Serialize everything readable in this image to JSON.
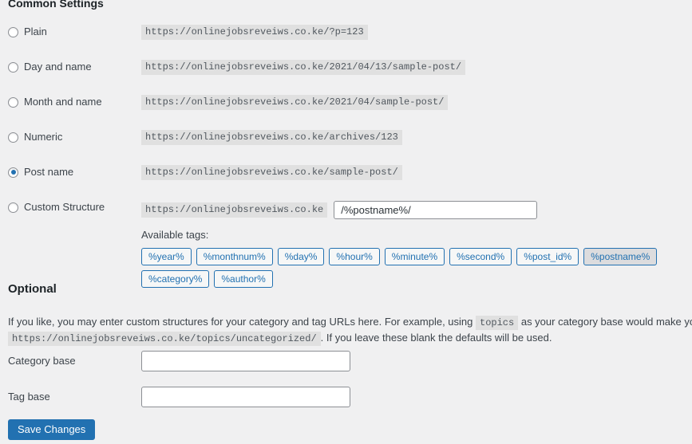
{
  "common_settings": {
    "heading": "Common Settings",
    "options": [
      {
        "label": "Plain",
        "example": "https://onlinejobsreveiws.co.ke/?p=123",
        "selected": false
      },
      {
        "label": "Day and name",
        "example": "https://onlinejobsreveiws.co.ke/2021/04/13/sample-post/",
        "selected": false
      },
      {
        "label": "Month and name",
        "example": "https://onlinejobsreveiws.co.ke/2021/04/sample-post/",
        "selected": false
      },
      {
        "label": "Numeric",
        "example": "https://onlinejobsreveiws.co.ke/archives/123",
        "selected": false
      },
      {
        "label": "Post name",
        "example": "https://onlinejobsreveiws.co.ke/sample-post/",
        "selected": true
      }
    ],
    "custom_structure": {
      "label": "Custom Structure",
      "selected": false,
      "prefix": "https://onlinejobsreveiws.co.ke",
      "value": "/%postname%/",
      "available_tags_label": "Available tags:",
      "tags": [
        {
          "label": "%year%",
          "active": false
        },
        {
          "label": "%monthnum%",
          "active": false
        },
        {
          "label": "%day%",
          "active": false
        },
        {
          "label": "%hour%",
          "active": false
        },
        {
          "label": "%minute%",
          "active": false
        },
        {
          "label": "%second%",
          "active": false
        },
        {
          "label": "%post_id%",
          "active": false
        },
        {
          "label": "%postname%",
          "active": true
        },
        {
          "label": "%category%",
          "active": false
        },
        {
          "label": "%author%",
          "active": false
        }
      ]
    }
  },
  "optional": {
    "heading": "Optional",
    "description_part1": "If you like, you may enter custom structures for your category and tag URLs here. For example, using",
    "description_code1": "topics",
    "description_part2": "as your category base would make your category links like",
    "description_code2": "https://onlinejobsreveiws.co.ke/topics/uncategorized/",
    "description_part3": ". If you leave these blank the defaults will be used.",
    "category_base_label": "Category base",
    "category_base_value": "",
    "category_base_placeholder": "",
    "tag_base_label": "Tag base",
    "tag_base_value": "",
    "tag_base_placeholder": ""
  },
  "submit": {
    "save_label": "Save Changes"
  },
  "colors": {
    "primary": "#2271b1",
    "page_background": "#f0f0f1",
    "code_background": "#e0e0e0",
    "text": "#3c434a"
  }
}
